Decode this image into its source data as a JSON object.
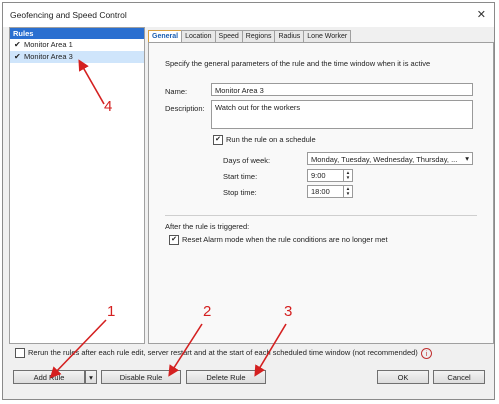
{
  "window": {
    "title": "Geofencing and Speed Control",
    "close": "✕"
  },
  "rules": {
    "header": "Rules",
    "items": [
      {
        "label": "Monitor Area 1",
        "checked": "✔"
      },
      {
        "label": "Monitor Area 3",
        "checked": "✔"
      }
    ]
  },
  "tabs": [
    "General",
    "Location",
    "Speed",
    "Regions",
    "Radius",
    "Lone Worker"
  ],
  "general": {
    "description": "Specify the general parameters of the rule and the time window when it is active",
    "name_label": "Name:",
    "name_value": "Monitor Area 3",
    "desc_label": "Description:",
    "desc_value": "Watch out for the workers",
    "schedule_label": "Run the rule on a schedule",
    "days_label": "Days of week:",
    "days_value": "Monday, Tuesday, Wednesday, Thursday, ...",
    "start_label": "Start time:",
    "start_value": "9:00",
    "stop_label": "Stop time:",
    "stop_value": "18:00",
    "after_label": "After the rule is triggered:",
    "reset_label": "Reset Alarm mode when the rule conditions are no longer met"
  },
  "bottom": {
    "rerun_label": "Rerun the rules after each rule edit, server restart and at the start of each scheduled time window (not recommended)",
    "info": "i"
  },
  "buttons": {
    "add": "Add Rule",
    "add_dropdown": "▾",
    "disable": "Disable Rule",
    "delete": "Delete Rule",
    "ok": "OK",
    "cancel": "Cancel"
  },
  "annotations": [
    "1",
    "2",
    "3",
    "4"
  ],
  "colors": {
    "annotation": "#d42020",
    "selection": "#cfe5fb",
    "rules_header": "#2a6fd0"
  }
}
